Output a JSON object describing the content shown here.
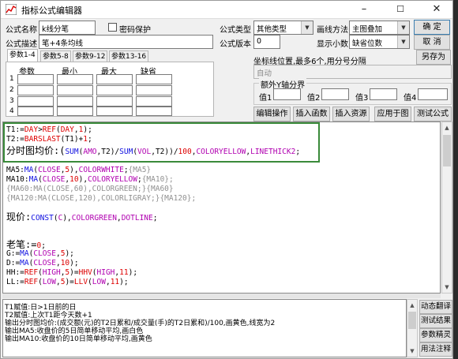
{
  "window": {
    "title": "指标公式编辑器",
    "min": "–",
    "max": "☐",
    "close": "✕"
  },
  "form": {
    "name_label": "公式名称",
    "name_value": "k线分笔",
    "protect_label": "密码保护",
    "desc_label": "公式描述",
    "desc_value": "笔+4条均线",
    "type_label": "公式类型",
    "type_value": "其他类型",
    "draw_label": "画线方法",
    "draw_value": "主图叠加",
    "version_label": "公式版本",
    "version_value": "0",
    "decimal_label": "显示小数",
    "decimal_value": "缺省位数",
    "coord_label": "坐标线位置,最多6个,用分号分隔",
    "coord_placeholder": "自动",
    "axis_group_label": "额外Y轴分界",
    "axis_v1": "值1",
    "axis_v2": "值2",
    "axis_v3": "值3",
    "axis_v4": "值4"
  },
  "buttons": {
    "ok": "确 定",
    "cancel": "取 消",
    "save_as": "另存为",
    "edit_op": "编辑操作",
    "insert_func": "插入函数",
    "insert_res": "插入资源",
    "apply": "应用于图",
    "test": "测试公式",
    "translate": "动态翻译",
    "test_result": "测试结果",
    "param_wizard": "参数精灵",
    "usage": "用法注释"
  },
  "tabs": [
    "参数1-4",
    "参数5-8",
    "参数9-12",
    "参数13-16"
  ],
  "params": {
    "headers": [
      "参数",
      "最小",
      "最大",
      "缺省"
    ],
    "rows": [
      "1",
      "2",
      "3",
      "4"
    ]
  },
  "code": {
    "l1a": "T1:=",
    "l1b": "DAY",
    "l1c": ">",
    "l1d": "REF",
    "l1e": "(",
    "l1f": "DAY",
    "l1g": ",",
    "l1h": "1",
    "l1i": ");",
    "l2a": "T2:=",
    "l2b": "BARSLAST",
    "l2c": "(T1)+",
    "l2d": "1",
    "l2e": ";",
    "l3a": "分时图均价:(",
    "l3b": "SUM",
    "l3c": "(",
    "l3d": "AMO",
    "l3e": ",T2)/",
    "l3f": "SUM",
    "l3g": "(",
    "l3h": "VOL",
    "l3i": ",T2))/",
    "l3j": "100",
    "l3k": ",",
    "l3l": "COLORYELLOW",
    "l3m": ",",
    "l3n": "LINETHICK2",
    "l3o": ";",
    "l4a": "MA5:",
    "l4b": "MA",
    "l4c": "(",
    "l4d": "CLOSE",
    "l4e": ",",
    "l4f": "5",
    "l4g": "),",
    "l4h": "COLORWHITE",
    "l4i": ";",
    "l4j": "{MA5}",
    "l5a": "MA10:",
    "l5b": "MA",
    "l5c": "(",
    "l5d": "CLOSE",
    "l5e": ",",
    "l5f": "10",
    "l5g": "),",
    "l5h": "COLORYELLOW",
    "l5i": ";",
    "l5j": "{MA10};",
    "l6": "{MA60:MA(CLOSE,60),COLORGREEN;}{MA60}",
    "l7": "{MA120:MA(CLOSE,120),COLORLIGRAY;}{MA120};",
    "l8a": "现价:",
    "l8b": "CONST",
    "l8c": "(",
    "l8d": "C",
    "l8e": "),",
    "l8f": "COLORGREEN",
    "l8g": ",",
    "l8h": "DOTLINE",
    "l8i": ";",
    "l9a": "老笔:=",
    "l9b": "0",
    "l9c": ";",
    "l10a": "G:=",
    "l10b": "MA",
    "l10c": "(",
    "l10d": "CLOSE",
    "l10e": ",",
    "l10f": "5",
    "l10g": ");",
    "l11a": "D:=",
    "l11b": "MA",
    "l11c": "(",
    "l11d": "CLOSE",
    "l11e": ",",
    "l11f": "10",
    "l11g": ");",
    "l12a": "HH:=",
    "l12b": "REF",
    "l12c": "(",
    "l12d": "HIGH",
    "l12e": ",",
    "l12f": "5",
    "l12g": ")=",
    "l12h": "HHV",
    "l12i": "(",
    "l12j": "HIGH",
    "l12k": ",",
    "l12l": "11",
    "l12m": ");",
    "l13a": "LL:=",
    "l13b": "REF",
    "l13c": "(",
    "l13d": "LOW",
    "l13e": ",",
    "l13f": "5",
    "l13g": ")=",
    "l13h": "LLV",
    "l13i": "(",
    "l13j": "LOW",
    "l13k": ",",
    "l13l": "11",
    "l13m": ");"
  },
  "description": [
    "T1赋值:日>1日前的日",
    "T2赋值:上次T1距今天数+1",
    "输出分时图均价:(成交额(元)的T2日累和/成交量(手)的T2日累和)/100,画黄色,线宽为2",
    "输出MA5:收盘价的5日简单移动平均,画白色",
    "输出MA10:收盘价的10日简单移动平均,画黄色"
  ]
}
